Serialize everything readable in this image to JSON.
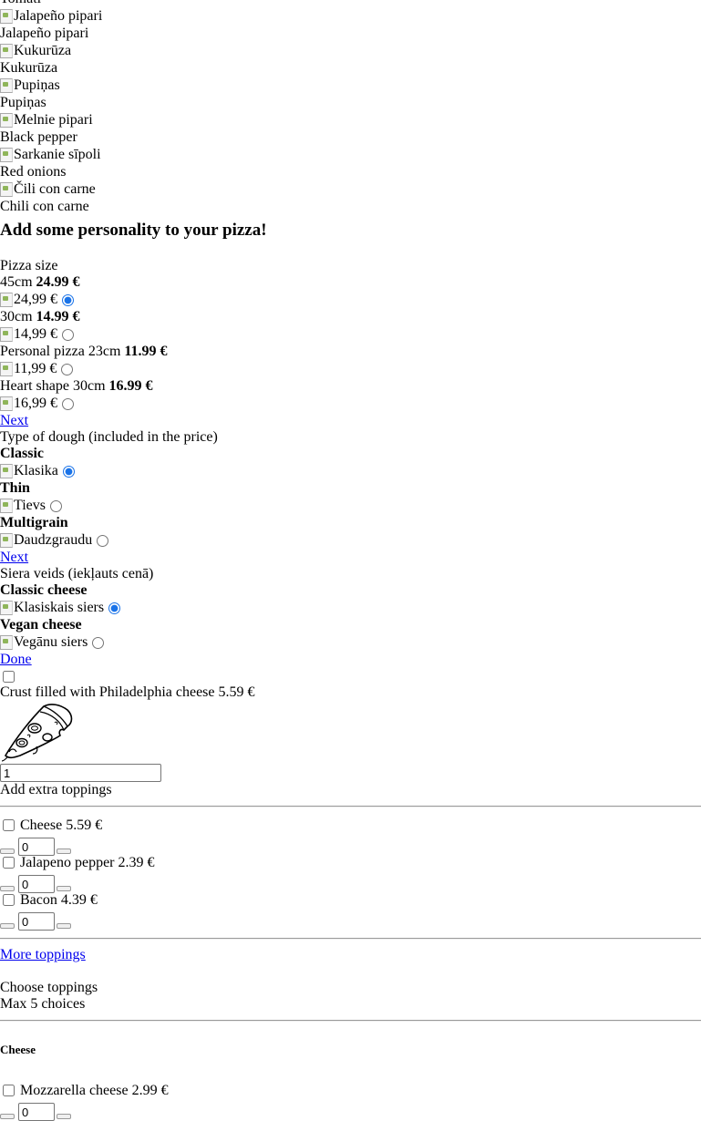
{
  "veg_list": [
    {
      "name": "Tomāti",
      "alt": ""
    },
    {
      "alt": "Jalapeño pipari",
      "name": "Jalapeño pipari"
    },
    {
      "alt": "Kukurūza",
      "name": "Kukurūza"
    },
    {
      "alt": "Pupiņas",
      "name": "Pupiņas"
    },
    {
      "alt": "Melnie pipari",
      "name": "Black pepper"
    },
    {
      "alt": "Sarkanie sīpoli",
      "name": "Red onions"
    },
    {
      "alt": "Čili con carne",
      "name": "Chili con carne"
    }
  ],
  "personality_heading": "Add some personality to your pizza!",
  "size": {
    "title": "Pizza size",
    "options": [
      {
        "label": "45cm",
        "price": "24.99 €",
        "img_alt": "24,99 €",
        "selected": true
      },
      {
        "label": "30cm",
        "price": "14.99 €",
        "img_alt": "14,99 €",
        "selected": false
      },
      {
        "label": "Personal pizza 23cm",
        "price": "11.99 €",
        "img_alt": "11,99 €",
        "selected": false
      },
      {
        "label": "Heart shape 30cm",
        "price": "16.99 €",
        "img_alt": "16,99 €",
        "selected": false
      }
    ],
    "next": "Next"
  },
  "dough": {
    "title": "Type of dough (included in the price)",
    "options": [
      {
        "label": "Classic",
        "img_alt": "Klasika",
        "selected": true
      },
      {
        "label": "Thin",
        "img_alt": "Tievs",
        "selected": false
      },
      {
        "label": "Multigrain",
        "img_alt": "Daudzgraudu",
        "selected": false
      }
    ],
    "next": "Next"
  },
  "cheese_type": {
    "title": "Siera veids (iekļauts cenā)",
    "options": [
      {
        "label": "Classic cheese",
        "img_alt": "Klasiskais siers",
        "selected": true
      },
      {
        "label": "Vegan cheese",
        "img_alt": "Vegānu siers",
        "selected": false
      }
    ],
    "done": "Done"
  },
  "crust": {
    "label": "Crust filled with Philadelphia cheese",
    "price": "5.59 €",
    "checked": false
  },
  "quantity": "1",
  "extra": {
    "title": "Add extra toppings",
    "items": [
      {
        "name": "Cheese",
        "price": "5.59 €",
        "qty": "0"
      },
      {
        "name": "Jalapeno pepper",
        "price": "2.39 €",
        "qty": "0"
      },
      {
        "name": "Bacon",
        "price": "4.39 €",
        "qty": "0"
      }
    ],
    "more": "More toppings"
  },
  "choose": {
    "title": "Choose toppings",
    "max": "Max 5 choices",
    "group": "Cheese",
    "items": [
      {
        "name": "Mozzarella cheese",
        "price": "2.99 €",
        "qty": "0"
      }
    ]
  }
}
